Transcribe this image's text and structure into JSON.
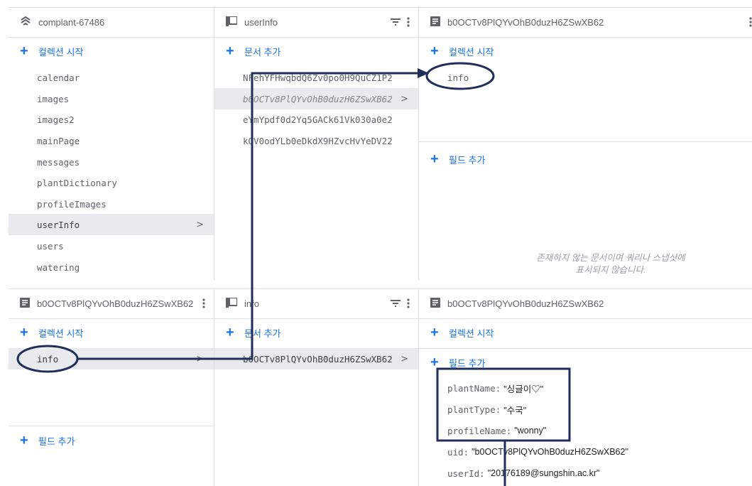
{
  "top": {
    "project": {
      "title": "complant-67486",
      "start_collection": "컬렉션 시작"
    },
    "collections": [
      "calendar",
      "images",
      "images2",
      "mainPage",
      "messages",
      "plantDictionary",
      "profileImages",
      "userInfo",
      "users",
      "watering"
    ],
    "selected_collection": "userInfo",
    "userinfo": {
      "title": "userInfo",
      "add_document": "문서 추가",
      "documents": [
        "NFehYFHwqbdQ6Zv0po0H9QuCZ1P2",
        "b0OCTv8PlQYvOhB0duzH6ZSwXB62",
        "eYmYpdf0d2Yq5GACk61Vk030a0e2",
        "kOV0odYLb0eDkdX9HZvcHvYeDV22"
      ]
    },
    "doc": {
      "title": "b0OCTv8PlQYvOhB0duzH6ZSwXB62",
      "start_collection": "컬렉션 시작",
      "subcollections": [
        "info"
      ],
      "add_field": "필드 추가",
      "missing_note_line1": "존재하지 않는 문서이며 쿼리나 스냅샷에",
      "missing_note_line2": "표시되지 않습니다."
    }
  },
  "bottom": {
    "doc": {
      "title": "b0OCTv8PlQYvOhB0duzH6ZSwXB62",
      "start_collection": "컬렉션 시작",
      "subcollections": [
        "info"
      ],
      "add_field": "필드 추가"
    },
    "info": {
      "title": "info",
      "add_document": "문서 추가",
      "documents": [
        "b0OCTv8PlQYvOhB0duzH6ZSwXB62"
      ]
    },
    "detail": {
      "title": "b0OCTv8PlQYvOhB0duzH6ZSwXB62",
      "start_collection": "컬렉션 시작",
      "add_field": "필드 추가",
      "fields": [
        {
          "key": "plantName:",
          "value": "\"싱글이♡\""
        },
        {
          "key": "plantType:",
          "value": "\"수국\""
        },
        {
          "key": "profileName:",
          "value": "\"wonny\""
        },
        {
          "key": "uid:",
          "value": "\"b0OCTv8PlQYvOhB0duzH6ZSwXB62\""
        },
        {
          "key": "userId:",
          "value": "\"20176189@sungshin.ac.kr\""
        }
      ]
    }
  },
  "colors": {
    "accent": "#1a73e8",
    "annotation": "#1f2e5a",
    "selected_bg": "#e8eaed",
    "border": "#e0e0e0"
  }
}
